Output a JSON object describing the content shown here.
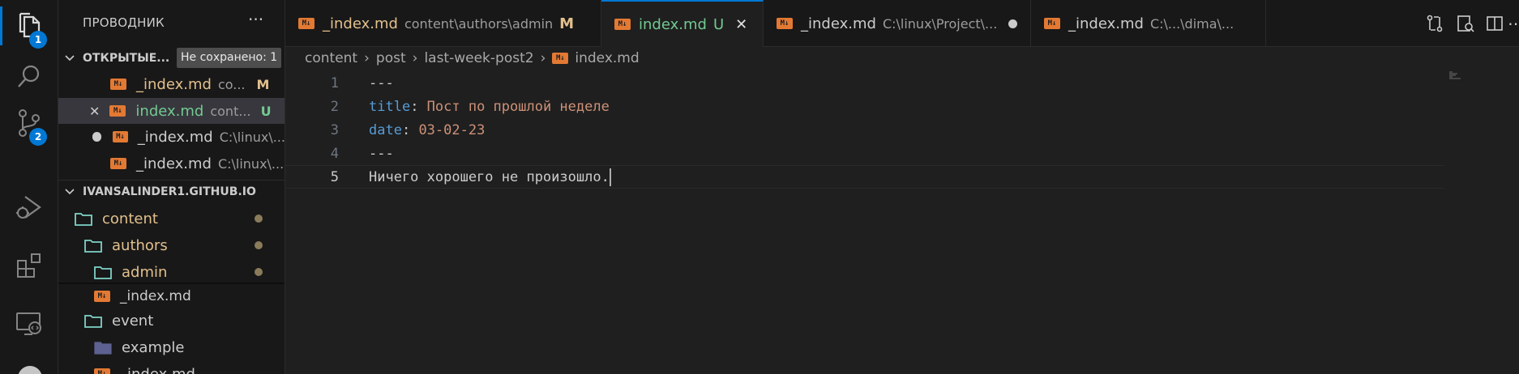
{
  "activity_bar": {
    "explorer_badge": "1",
    "scm_badge": "2"
  },
  "sidebar": {
    "title": "ПРОВОДНИК",
    "more": "···",
    "open_editors": {
      "header": "ОТКРЫТЫЕ...",
      "unsaved_tooltip": "Не сохранено: 1",
      "items": [
        {
          "name": "_index.md",
          "desc": "co...",
          "flag": "M"
        },
        {
          "name": "index.md",
          "desc": "cont...",
          "flag": "U"
        },
        {
          "name": "_index.md",
          "desc": "C:\\linux\\..."
        },
        {
          "name": "_index.md",
          "desc": "C:\\linux\\..."
        }
      ]
    },
    "repo": {
      "header": "IVANSALINDER1.GITHUB.IO",
      "items": [
        {
          "name": "content"
        },
        {
          "name": "authors"
        },
        {
          "name": "admin"
        },
        {
          "name": "_index.md"
        },
        {
          "name": "event"
        },
        {
          "name": "example"
        },
        {
          "name": "_index.md"
        }
      ]
    }
  },
  "tabs": [
    {
      "name": "_index.md",
      "desc": "content\\authors\\admin",
      "flag": "M"
    },
    {
      "name": "index.md",
      "flag": "U",
      "close": "✕"
    },
    {
      "name": "_index.md",
      "desc": "C:\\linux\\Project\\..."
    },
    {
      "name": "_index.md",
      "desc": "C:\\...\\dima\\..."
    }
  ],
  "breadcrumb": [
    "content",
    "post",
    "last-week-post2",
    "index.md"
  ],
  "editor": {
    "lines": [
      {
        "n": "1",
        "text": "---"
      },
      {
        "n": "2",
        "key": "title",
        "colon": ": ",
        "value": "Пост по прошлой неделе"
      },
      {
        "n": "3",
        "key": "date",
        "colon": ": ",
        "value": "03-02-23"
      },
      {
        "n": "4",
        "text": "---"
      },
      {
        "n": "5",
        "text": "Ничего хорошего не произошло."
      }
    ]
  },
  "colors": {
    "accent": "#0078d4",
    "modified": "#e2c08d",
    "untracked": "#73c991",
    "markdown_icon": "#e37933"
  }
}
